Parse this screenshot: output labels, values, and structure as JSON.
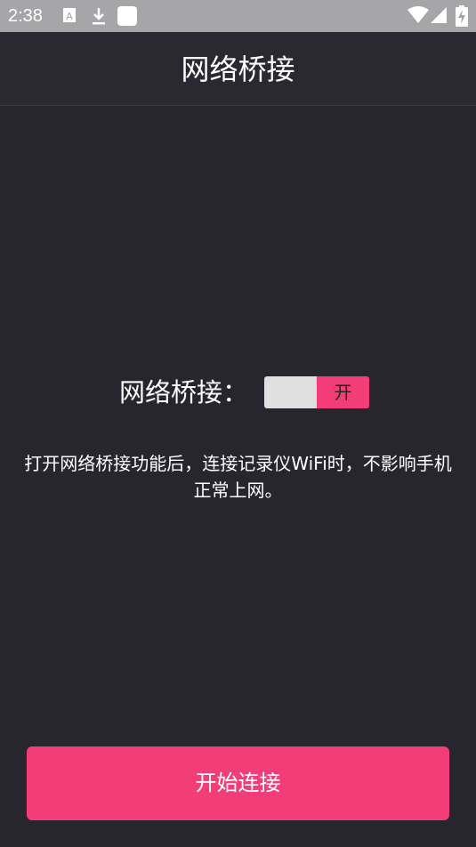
{
  "status_bar": {
    "time": "2:38",
    "icons": [
      "keyboard-a-icon",
      "download-icon",
      "app-square-icon",
      "wifi-icon",
      "signal-icon",
      "battery-charging-icon"
    ]
  },
  "header": {
    "title": "网络桥接"
  },
  "bridge": {
    "label": "网络桥接：",
    "toggle_state_label": "开",
    "toggle_on": true
  },
  "description": "打开网络桥接功能后，连接记录仪WiFi时，不影响手机正常上网。",
  "actions": {
    "start_label": "开始连接"
  },
  "colors": {
    "accent": "#f23d78",
    "background": "#27252d",
    "status_bar": "#a6a6a8"
  }
}
